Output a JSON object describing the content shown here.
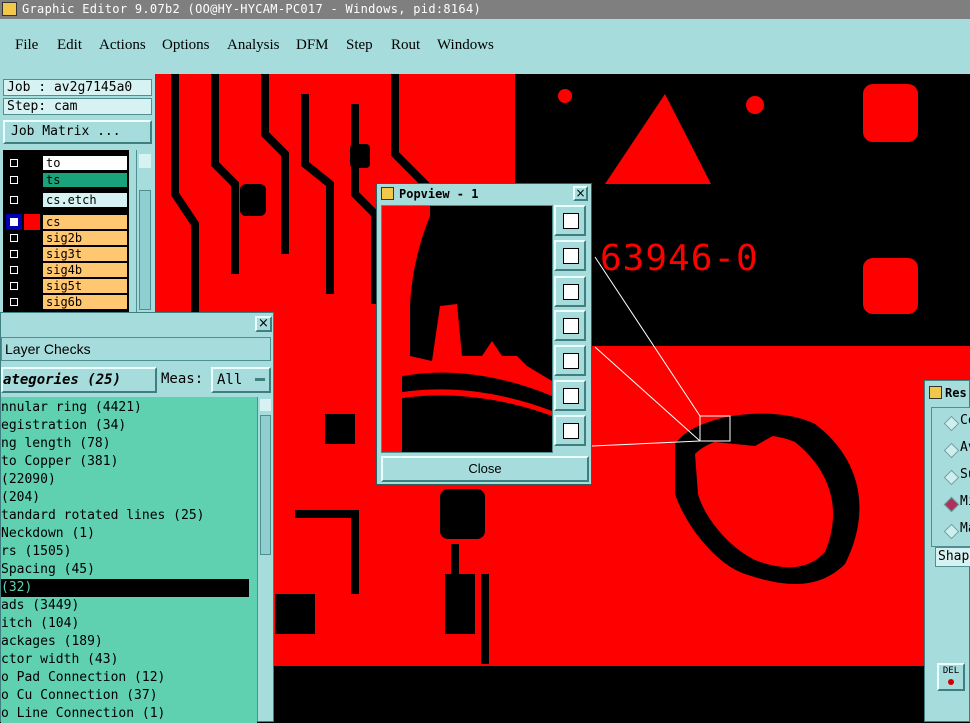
{
  "window": {
    "title": "Graphic Editor 9.07b2 (OO@HY-HYCAM-PC017 - Windows, pid:8164)"
  },
  "menu": [
    "File",
    "Edit",
    "Actions",
    "Options",
    "Analysis",
    "DFM",
    "Step",
    "Rout",
    "Windows"
  ],
  "job": {
    "job_label": "Job : av2g7145a0",
    "step_label": "Step: cam",
    "matrix_button": "Job Matrix ..."
  },
  "layers": [
    {
      "name": "to",
      "color": "#ffffff"
    },
    {
      "name": "ts",
      "color": "#1aa37a"
    },
    {
      "name": "cs.etch",
      "color": "#d7f2f2"
    },
    {
      "name": "cs",
      "color": "#ffc770"
    },
    {
      "name": "sig2b",
      "color": "#ffc770"
    },
    {
      "name": "sig3t",
      "color": "#ffc770"
    },
    {
      "name": "sig4b",
      "color": "#ffc770"
    },
    {
      "name": "sig5t",
      "color": "#ffc770"
    },
    {
      "name": "sig6b",
      "color": "#ffc770"
    }
  ],
  "checks": {
    "title": "Layer Checks",
    "categories_label": "ategories (25)",
    "meas_label": "Meas:",
    "meas_value": "All",
    "items": [
      "nnular ring (4421)",
      "egistration (34)",
      "ng length (78)",
      "to Copper (381)",
      "(22090)",
      " (204)",
      "tandard rotated lines (25)",
      "Neckdown (1)",
      "rs (1505)",
      " Spacing (45)",
      " (32)",
      "ads (3449)",
      "itch (104)",
      "ackages (189)",
      "ctor width (43)",
      "o Pad Connection (12)",
      "o Cu Connection (37)",
      "o Line Connection (1)"
    ],
    "selected_index": 10
  },
  "popview": {
    "title": "Popview - 1",
    "close_label": "Close"
  },
  "canvas": {
    "part_number": "63946-0"
  },
  "results": {
    "title": "Res",
    "options": [
      "Co",
      "Av",
      "Su",
      "Mi",
      "Ma"
    ],
    "selected_index": 3,
    "shape_label": "Shap",
    "del_label": "DEL"
  },
  "colors": {
    "copper": "#ff0000",
    "bg": "#000000",
    "panel": "#a6dcdc",
    "list": "#5fd0b0"
  }
}
